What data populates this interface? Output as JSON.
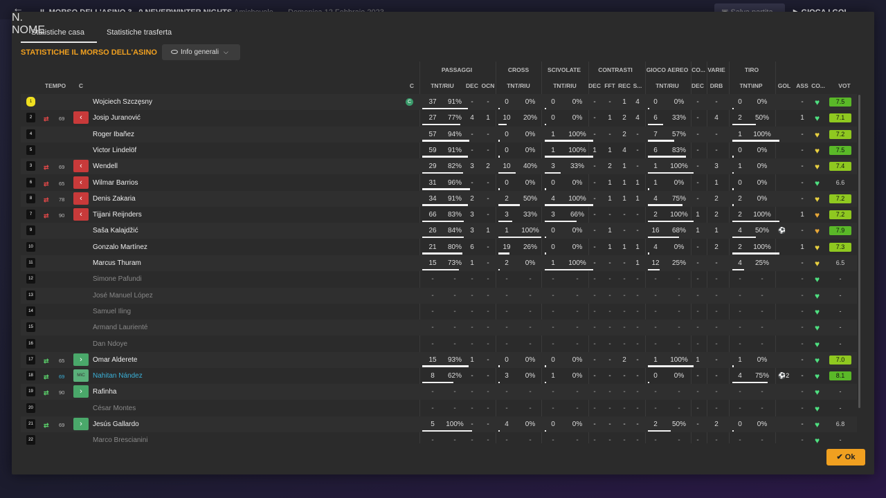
{
  "bg": {
    "match": "IL MORSO DELL'ASINO  3 - 0  NEVERWINTER NIGHTS",
    "type": "Amichevole",
    "date": "Domenica 12 Febbraio 2023",
    "save": "Salva partita",
    "play": "GIOCA I GOL"
  },
  "tabs": [
    "Statistiche casa",
    "Statistiche trasferta"
  ],
  "section_title": "STATISTICHE IL MORSO DELL'ASINO",
  "dropdown": "Info generali",
  "ok": "Ok",
  "groups": [
    "PASSAGGI",
    "CROSS",
    "SCIVOLATE",
    "CONTRASTI",
    "GIOCO AEREO",
    "CO...",
    "VARIE",
    "TIRO"
  ],
  "headers": {
    "n": "N.",
    "tempo": "TEMPO",
    "c": "C",
    "nome": "NOME",
    "capt": "C",
    "pass": "TNT/RIU",
    "dec1": "DEC",
    "ocn": "OCN",
    "cross": "TNT/RIU",
    "sciv": "TNT/RIU",
    "dec2": "DEC",
    "fft": "FFT",
    "rec": "REC",
    "s": "S...",
    "aereo": "TNT/RIU",
    "dec3": "DEC",
    "drb": "DRB",
    "tiro": "TNT\\INP",
    "gol": "GOL",
    "ass": "ASS",
    "co": "CO...",
    "vot": "VOT"
  },
  "players": [
    {
      "num": "1",
      "name": "Wojciech Szczęsny",
      "gk": true,
      "cap": "C",
      "pass": [
        "37",
        "91%"
      ],
      "dec1": "-",
      "ocn": "-",
      "cross": [
        "0",
        "0%"
      ],
      "sciv": [
        "0",
        "0%"
      ],
      "dec2": "-",
      "fft": "-",
      "rec": "1",
      "s": "4",
      "aereo": [
        "0",
        "0%"
      ],
      "dec3": "-",
      "drb": "-",
      "tiro": [
        "0",
        "0%"
      ],
      "gol": "",
      "ass": "-",
      "heart": "g",
      "vote": "7.5"
    },
    {
      "num": "2",
      "name": "Josip Juranović",
      "sub": "out",
      "min": "69",
      "pass": [
        "27",
        "77%"
      ],
      "dec1": "4",
      "ocn": "1",
      "cross": [
        "10",
        "20%"
      ],
      "sciv": [
        "0",
        "0%"
      ],
      "dec2": "-",
      "fft": "1",
      "rec": "2",
      "s": "4",
      "aereo": [
        "6",
        "33%"
      ],
      "dec3": "-",
      "drb": "4",
      "tiro": [
        "2",
        "50%"
      ],
      "gol": "",
      "ass": "1",
      "heart": "g",
      "vote": "7.1"
    },
    {
      "num": "4",
      "name": "Roger Ibañez",
      "pass": [
        "57",
        "94%"
      ],
      "dec1": "-",
      "ocn": "-",
      "cross": [
        "0",
        "0%"
      ],
      "sciv": [
        "1",
        "100%"
      ],
      "dec2": "-",
      "fft": "-",
      "rec": "2",
      "s": "-",
      "aereo": [
        "7",
        "57%"
      ],
      "dec3": "-",
      "drb": "-",
      "tiro": [
        "1",
        "100%"
      ],
      "gol": "",
      "ass": "-",
      "heart": "y",
      "vote": "7.2"
    },
    {
      "num": "5",
      "name": "Victor Lindelöf",
      "pass": [
        "59",
        "91%"
      ],
      "dec1": "-",
      "ocn": "-",
      "cross": [
        "0",
        "0%"
      ],
      "sciv": [
        "1",
        "100%"
      ],
      "dec2": "1",
      "fft": "1",
      "rec": "4",
      "s": "-",
      "aereo": [
        "6",
        "83%"
      ],
      "dec3": "-",
      "drb": "-",
      "tiro": [
        "0",
        "0%"
      ],
      "gol": "",
      "ass": "-",
      "heart": "y",
      "vote": "7.5"
    },
    {
      "num": "3",
      "name": "Wendell",
      "sub": "out",
      "min": "69",
      "pass": [
        "29",
        "82%"
      ],
      "dec1": "3",
      "ocn": "2",
      "cross": [
        "10",
        "40%"
      ],
      "sciv": [
        "3",
        "33%"
      ],
      "dec2": "-",
      "fft": "2",
      "rec": "1",
      "s": "-",
      "aereo": [
        "1",
        "100%"
      ],
      "dec3": "-",
      "drb": "3",
      "tiro": [
        "1",
        "0%"
      ],
      "gol": "",
      "ass": "-",
      "heart": "y",
      "vote": "7.4"
    },
    {
      "num": "6",
      "name": "Wilmar Barrios",
      "sub": "out",
      "min": "65",
      "pass": [
        "31",
        "96%"
      ],
      "dec1": "-",
      "ocn": "-",
      "cross": [
        "0",
        "0%"
      ],
      "sciv": [
        "0",
        "0%"
      ],
      "dec2": "-",
      "fft": "1",
      "rec": "1",
      "s": "1",
      "aereo": [
        "1",
        "0%"
      ],
      "dec3": "-",
      "drb": "1",
      "tiro": [
        "0",
        "0%"
      ],
      "gol": "",
      "ass": "-",
      "heart": "g",
      "vote": "6.6"
    },
    {
      "num": "8",
      "name": "Denis Zakaria",
      "sub": "out",
      "min": "78",
      "pass": [
        "34",
        "91%"
      ],
      "dec1": "2",
      "ocn": "-",
      "cross": [
        "2",
        "50%"
      ],
      "sciv": [
        "4",
        "100%"
      ],
      "dec2": "-",
      "fft": "1",
      "rec": "1",
      "s": "1",
      "aereo": [
        "4",
        "75%"
      ],
      "dec3": "-",
      "drb": "2",
      "tiro": [
        "2",
        "0%"
      ],
      "gol": "",
      "ass": "-",
      "heart": "y",
      "vote": "7.2"
    },
    {
      "num": "7",
      "name": "Tijjani Reijnders",
      "sub": "out",
      "min": "90",
      "pass": [
        "66",
        "83%"
      ],
      "dec1": "3",
      "ocn": "-",
      "cross": [
        "3",
        "33%"
      ],
      "sciv": [
        "3",
        "66%"
      ],
      "dec2": "-",
      "fft": "-",
      "rec": "-",
      "s": "-",
      "aereo": [
        "2",
        "100%"
      ],
      "dec3": "1",
      "drb": "2",
      "tiro": [
        "2",
        "100%"
      ],
      "gol": "",
      "ass": "1",
      "heart": "o",
      "vote": "7.2"
    },
    {
      "num": "9",
      "name": "Saša Kalajdžić",
      "pass": [
        "26",
        "84%"
      ],
      "dec1": "3",
      "ocn": "1",
      "cross": [
        "1",
        "100%"
      ],
      "sciv": [
        "0",
        "0%"
      ],
      "dec2": "-",
      "fft": "1",
      "rec": "-",
      "s": "-",
      "aereo": [
        "16",
        "68%"
      ],
      "dec3": "1",
      "drb": "1",
      "tiro": [
        "4",
        "50%"
      ],
      "gol": "⚽",
      "ass": "-",
      "heart": "o",
      "vote": "7.9"
    },
    {
      "num": "10",
      "name": "Gonzalo Martínez",
      "pass": [
        "21",
        "80%"
      ],
      "dec1": "6",
      "ocn": "-",
      "cross": [
        "19",
        "26%"
      ],
      "sciv": [
        "0",
        "0%"
      ],
      "dec2": "-",
      "fft": "1",
      "rec": "1",
      "s": "1",
      "aereo": [
        "4",
        "0%"
      ],
      "dec3": "-",
      "drb": "2",
      "tiro": [
        "2",
        "100%"
      ],
      "gol": "",
      "ass": "1",
      "heart": "y",
      "vote": "7.3"
    },
    {
      "num": "11",
      "name": "Marcus Thuram",
      "pass": [
        "15",
        "73%"
      ],
      "dec1": "1",
      "ocn": "-",
      "cross": [
        "2",
        "0%"
      ],
      "sciv": [
        "1",
        "100%"
      ],
      "dec2": "-",
      "fft": "-",
      "rec": "-",
      "s": "1",
      "aereo": [
        "12",
        "25%"
      ],
      "dec3": "-",
      "drb": "-",
      "tiro": [
        "4",
        "25%"
      ],
      "gol": "",
      "ass": "-",
      "heart": "y",
      "vote": "6.5"
    },
    {
      "num": "12",
      "name": "Simone Pafundi",
      "dim": true
    },
    {
      "num": "13",
      "name": "José Manuel López",
      "dim": true
    },
    {
      "num": "14",
      "name": "Samuel Iling",
      "dim": true
    },
    {
      "num": "15",
      "name": "Armand Laurienté",
      "dim": true
    },
    {
      "num": "16",
      "name": "Dan Ndoye",
      "dim": true
    },
    {
      "num": "17",
      "name": "Omar Alderete",
      "sub": "in",
      "min": "65",
      "pass": [
        "15",
        "93%"
      ],
      "dec1": "1",
      "ocn": "-",
      "cross": [
        "0",
        "0%"
      ],
      "sciv": [
        "0",
        "0%"
      ],
      "dec2": "-",
      "fft": "-",
      "rec": "2",
      "s": "-",
      "aereo": [
        "1",
        "100%"
      ],
      "dec3": "1",
      "drb": "-",
      "tiro": [
        "1",
        "0%"
      ],
      "gol": "",
      "ass": "-",
      "heart": "g",
      "vote": "7.0"
    },
    {
      "num": "18",
      "name": "Nahitan Nández",
      "hl": true,
      "sub": "in",
      "min": "69",
      "mic": "MiC",
      "pass": [
        "8",
        "62%"
      ],
      "dec1": "-",
      "ocn": "-",
      "cross": [
        "3",
        "0%"
      ],
      "sciv": [
        "1",
        "0%"
      ],
      "dec2": "-",
      "fft": "-",
      "rec": "-",
      "s": "-",
      "aereo": [
        "0",
        "0%"
      ],
      "dec3": "-",
      "drb": "-",
      "tiro": [
        "4",
        "75%"
      ],
      "gol": "⚽2",
      "ass": "-",
      "heart": "g",
      "vote": "8.1"
    },
    {
      "num": "19",
      "name": "Rafinha",
      "sub": "in",
      "min": "90",
      "heart": "g"
    },
    {
      "num": "20",
      "name": "César Montes",
      "dim": true
    },
    {
      "num": "21",
      "name": "Jesús Gallardo",
      "sub": "in",
      "min": "69",
      "pass": [
        "5",
        "100%"
      ],
      "dec1": "-",
      "ocn": "-",
      "cross": [
        "4",
        "0%"
      ],
      "sciv": [
        "0",
        "0%"
      ],
      "dec2": "-",
      "fft": "-",
      "rec": "-",
      "s": "-",
      "aereo": [
        "2",
        "50%"
      ],
      "dec3": "-",
      "drb": "2",
      "tiro": [
        "0",
        "0%"
      ],
      "gol": "",
      "ass": "-",
      "heart": "g",
      "vote": "6.8"
    },
    {
      "num": "22",
      "name": "Marco Brescianini",
      "dim": true
    }
  ]
}
